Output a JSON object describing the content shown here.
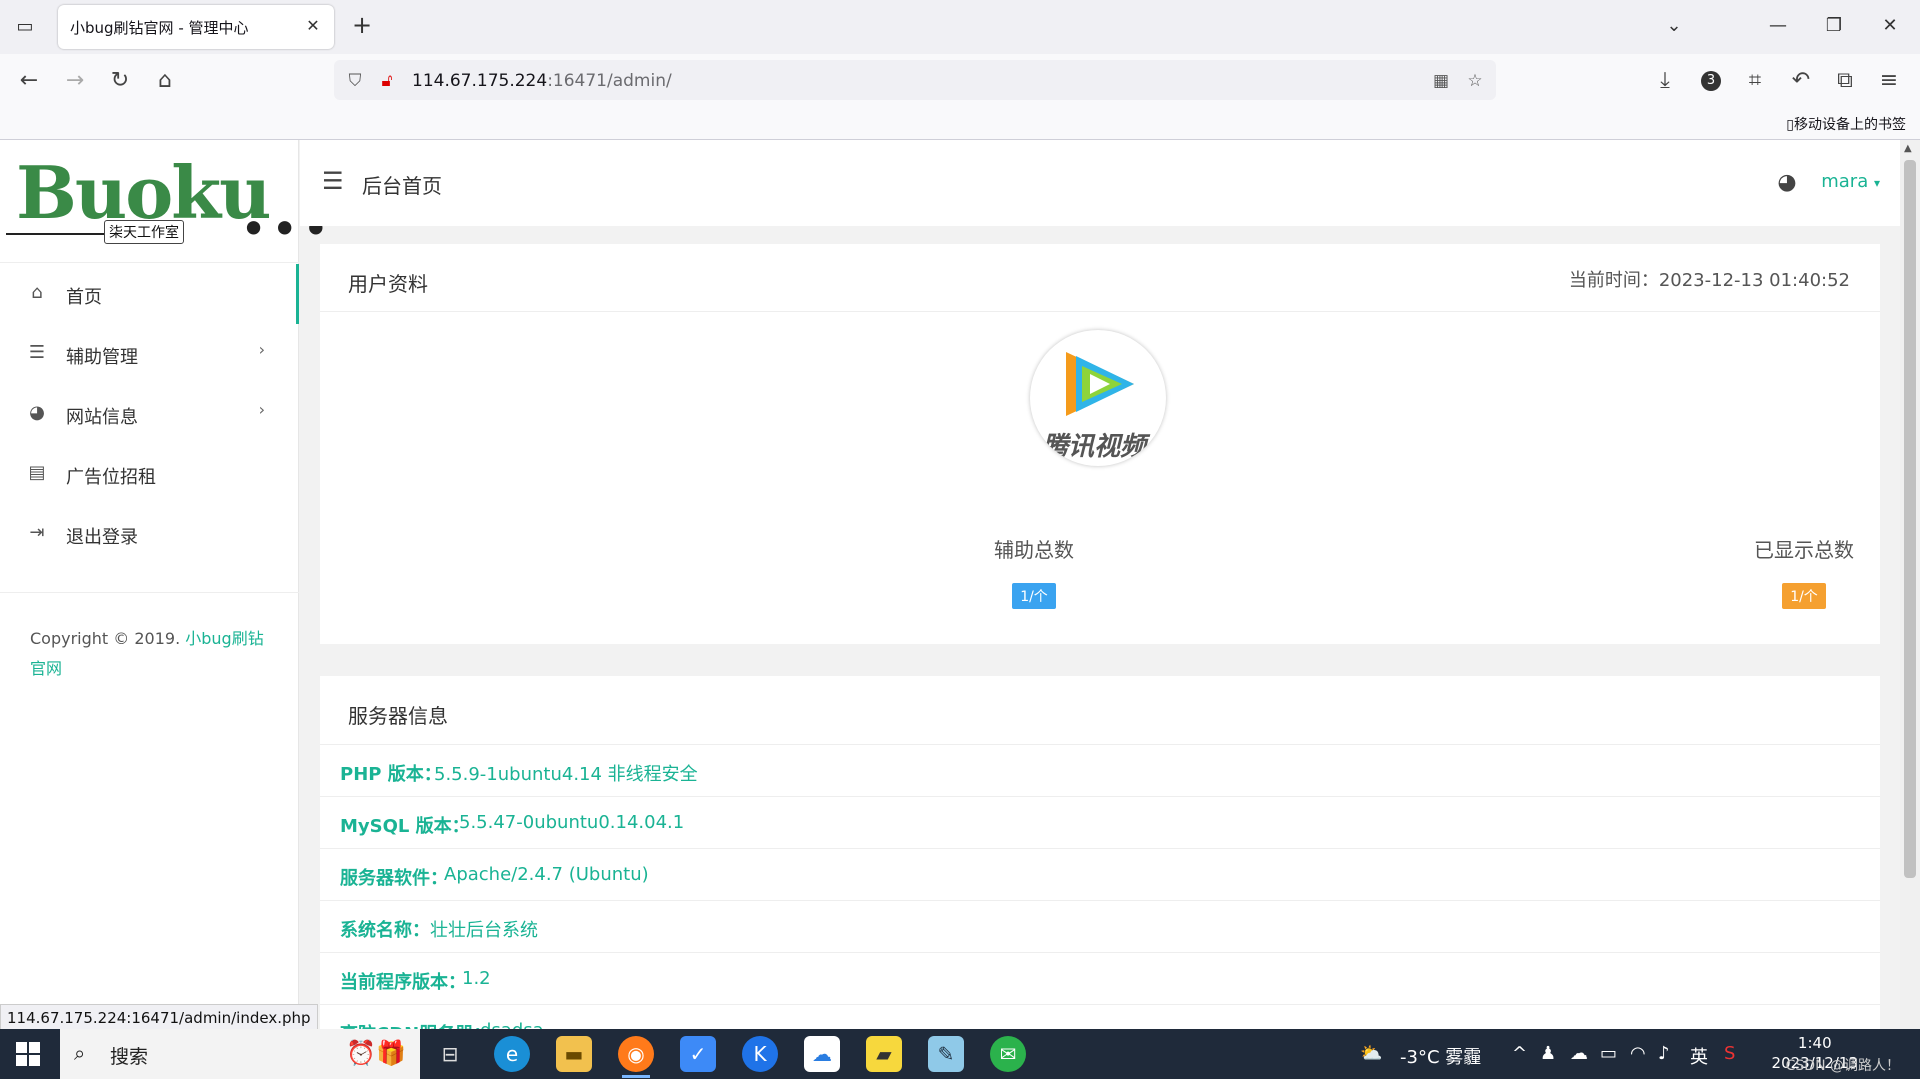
{
  "browser": {
    "tab_title": "小bug刷钻官网 - 管理中心",
    "url_host": "114.67.175.224",
    "url_rest": ":16471/admin/",
    "extensions_badge": "3",
    "bookmark_mobile": "移动设备上的书签",
    "status_url": "114.67.175.224:16471/admin/index.php"
  },
  "logo": {
    "text": "Buoku",
    "dots": "•••",
    "tag": "柒天工作室"
  },
  "sidebar": {
    "items": [
      {
        "label": "首页",
        "icon": "home-icon"
      },
      {
        "label": "辅助管理",
        "icon": "list-icon"
      },
      {
        "label": "网站信息",
        "icon": "palette-icon"
      },
      {
        "label": "广告位招租",
        "icon": "id-card-icon"
      },
      {
        "label": "退出登录",
        "icon": "logout-icon"
      }
    ],
    "copyright_prefix": "Copyright © 2019. ",
    "copyright_link": "小bug刷钻官网"
  },
  "header": {
    "title": "后台首页",
    "user": "mara"
  },
  "profile_card": {
    "title": "用户资料",
    "time_label": "当前时间：",
    "time_value": "2023-12-13 01:40:52",
    "avatar_caption": "腾讯视频",
    "stats": [
      {
        "label": "辅助总数",
        "value": "1/个",
        "color": "#3aa3f0"
      },
      {
        "label": "已显示总数",
        "value": "1/个",
        "color": "#f5a030"
      }
    ]
  },
  "server_card": {
    "title": "服务器信息",
    "rows": [
      {
        "key": "PHP 版本：",
        "value": "5.5.9-1ubuntu4.14 非线程安全"
      },
      {
        "key": "MySQL 版本：",
        "value": "5.5.47-0ubuntu0.14.04.1"
      },
      {
        "key": "服务器软件：",
        "value": "Apache/2.4.7 (Ubuntu)"
      },
      {
        "key": "系统名称：",
        "value": "壮壮后台系统"
      },
      {
        "key": "当前程序版本：",
        "value": "1.2"
      },
      {
        "key": "高防CDN服务器：",
        "value": "dsadsa"
      }
    ]
  },
  "taskbar": {
    "search": "搜索",
    "weather": "-3°C 雾霾",
    "ime": "英",
    "time": "1:40",
    "date": "2023/12/13",
    "watermark": "CSDN @调路人！"
  },
  "colors": {
    "accent": "#1ab394"
  }
}
